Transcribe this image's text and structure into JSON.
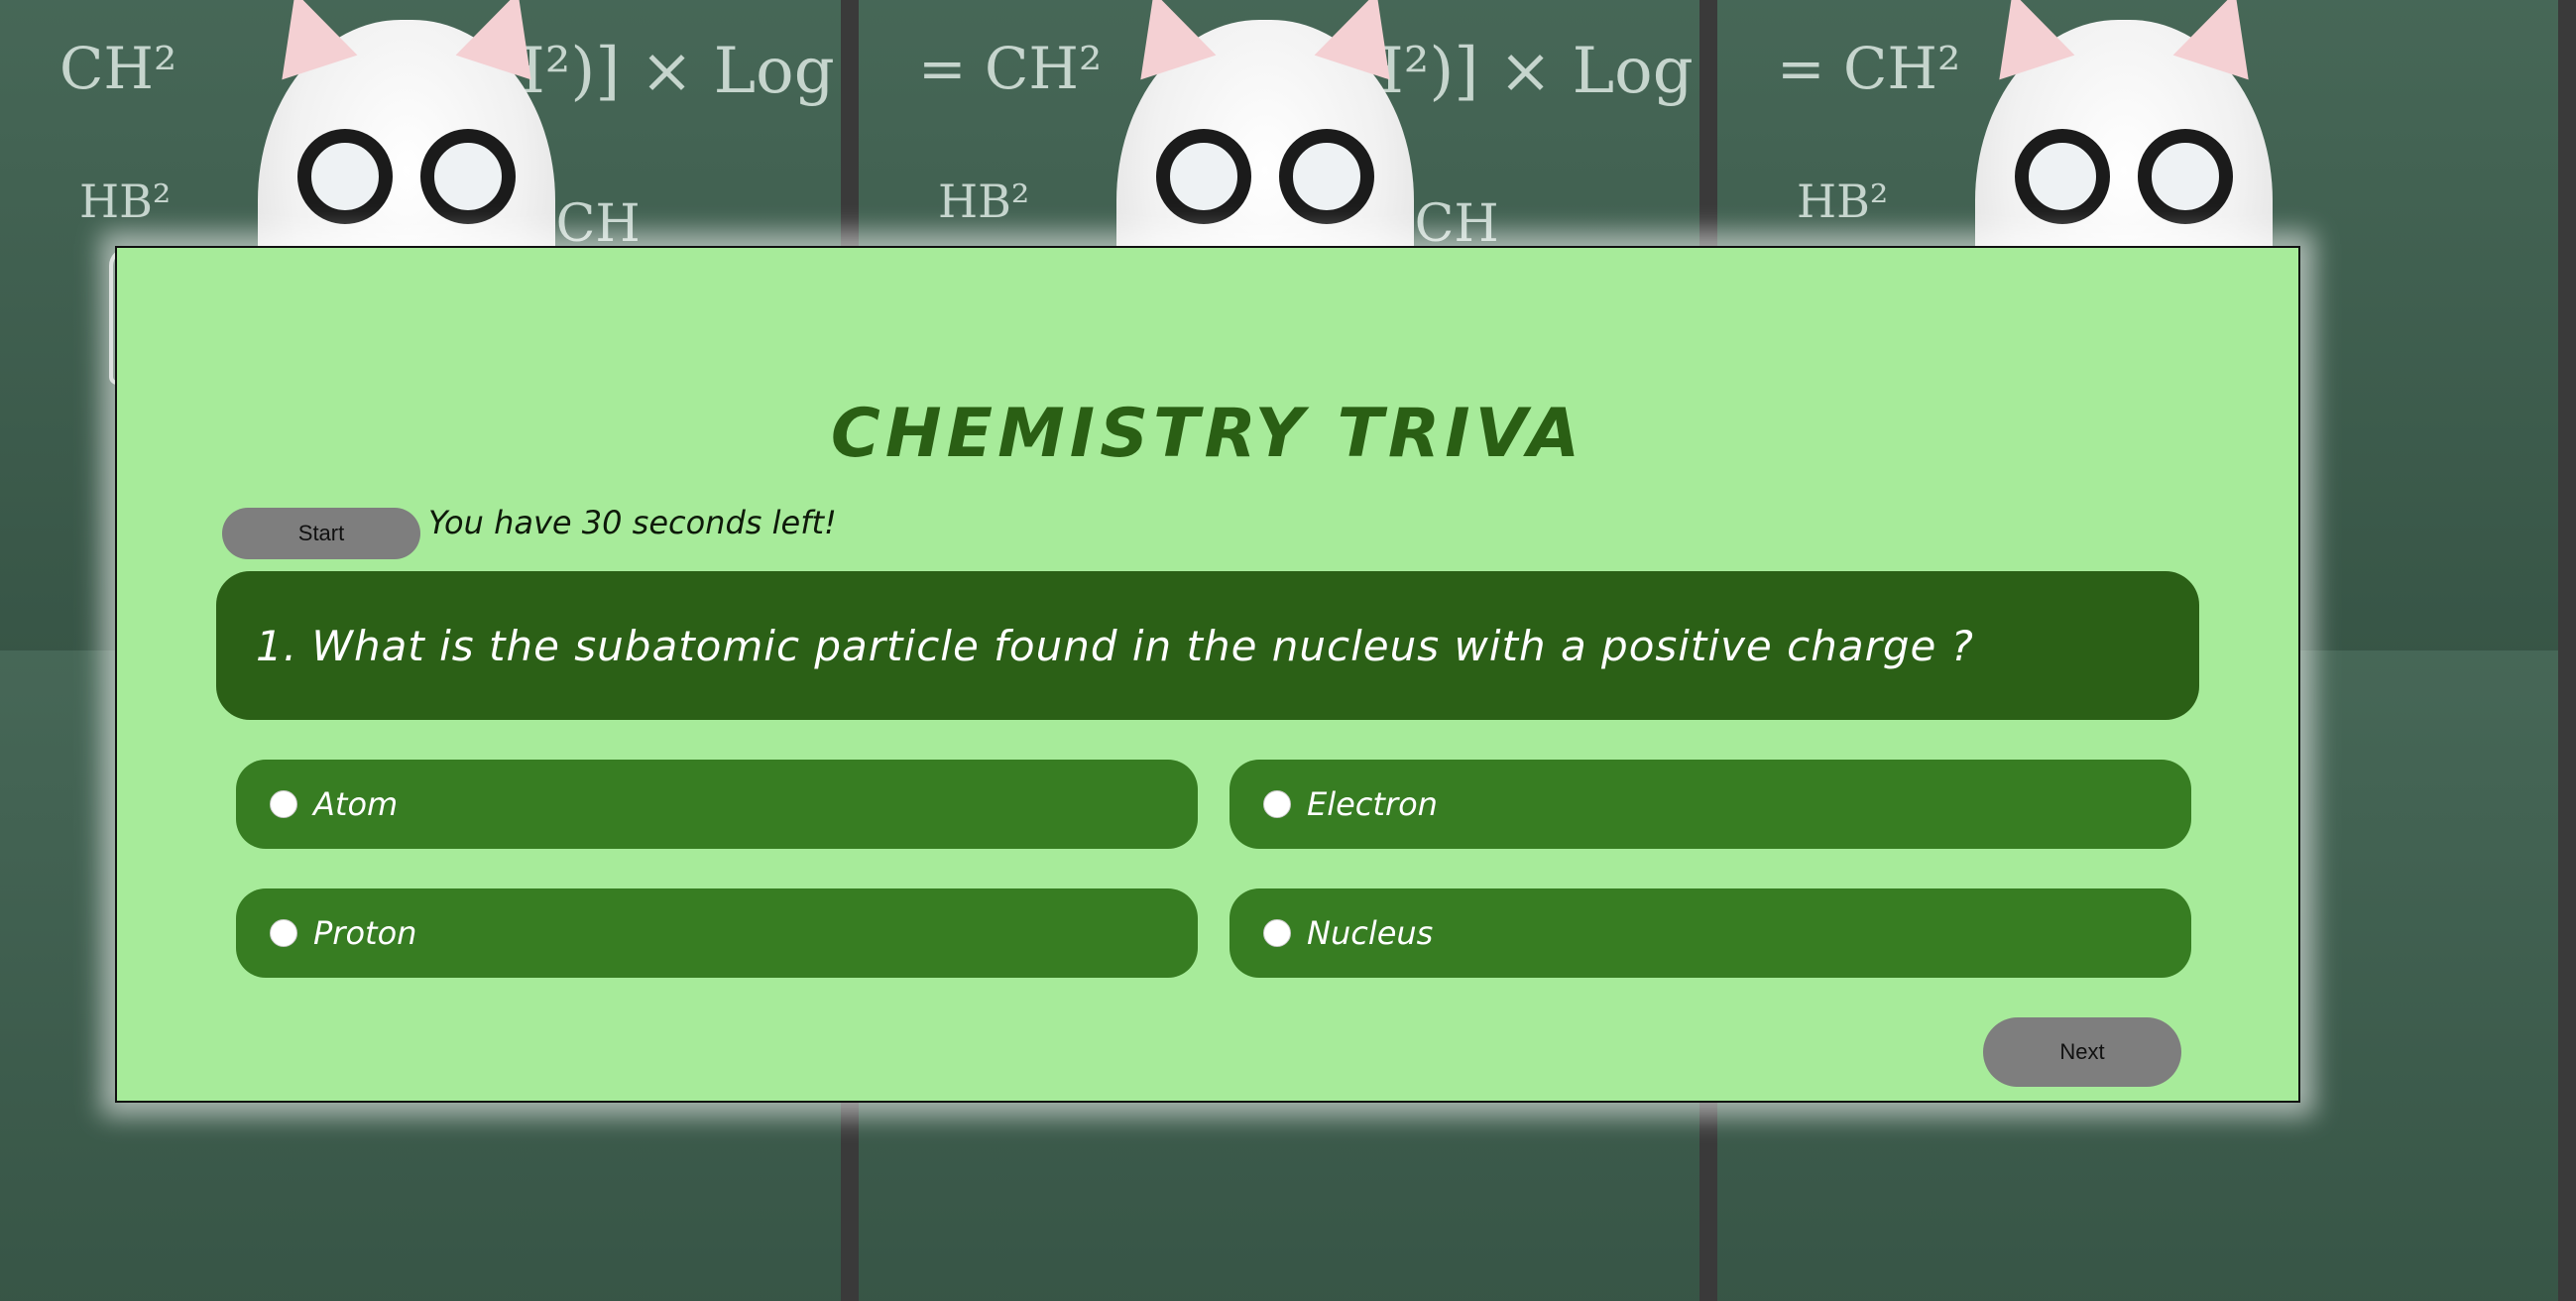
{
  "page": {
    "title": "CHEMISTRY TRIVA"
  },
  "controls": {
    "start_label": "Start",
    "next_label": "Next"
  },
  "timer": {
    "text": "You have 30 seconds left!"
  },
  "question": {
    "text": "1. What is the subatomic particle found in the nucleus with a positive charge ?"
  },
  "options": [
    {
      "label": "Atom",
      "selected": false
    },
    {
      "label": "Electron",
      "selected": false
    },
    {
      "label": "Proton",
      "selected": false
    },
    {
      "label": "Nucleus",
      "selected": false
    }
  ],
  "colors": {
    "card_background": "#a7eb9a",
    "title": "#2a5f14",
    "question_background": "#2b6016",
    "option_background": "#377d22",
    "button_background": "#7e7e7e"
  }
}
